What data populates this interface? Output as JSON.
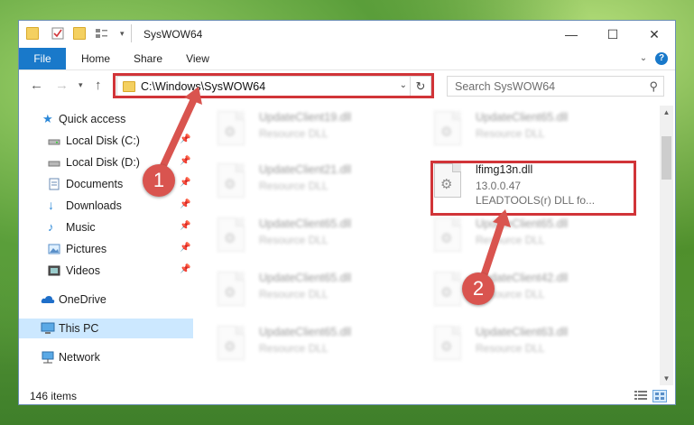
{
  "window": {
    "title": "SysWOW64",
    "controls": [
      "—",
      "☐",
      "✕"
    ]
  },
  "ribbon": {
    "tabs": [
      "File",
      "Home",
      "Share",
      "View"
    ],
    "help": "?"
  },
  "nav": {
    "address": "C:\\Windows\\SysWOW64",
    "search_placeholder": "Search SysWOW64"
  },
  "sidebar": {
    "items": [
      {
        "label": "Quick access",
        "icon": "star-icon"
      },
      {
        "label": "Local Disk (C:)",
        "icon": "drive-icon"
      },
      {
        "label": "Local Disk (D:)",
        "icon": "drive-icon"
      },
      {
        "label": "Documents",
        "icon": "documents-icon"
      },
      {
        "label": "Downloads",
        "icon": "download-icon"
      },
      {
        "label": "Music",
        "icon": "music-icon"
      },
      {
        "label": "Pictures",
        "icon": "pictures-icon"
      },
      {
        "label": "Videos",
        "icon": "videos-icon"
      },
      {
        "label": "OneDrive",
        "icon": "cloud-icon"
      },
      {
        "label": "This PC",
        "icon": "computer-icon"
      },
      {
        "label": "Network",
        "icon": "network-icon"
      }
    ]
  },
  "files": [
    {
      "name": "UpdateClient19.dll",
      "line2": "Resource DLL"
    },
    {
      "name": "UpdateClient65.dll",
      "line2": "Resource DLL"
    },
    {
      "name": "UpdateClient21.dll",
      "line2": "Resource DLL"
    },
    {
      "name": "lfimg13n.dll",
      "line2": "13.0.0.47",
      "line3": "LEADTOOLS(r) DLL fo..."
    },
    {
      "name": "UpdateClient65.dll",
      "line2": "Resource DLL"
    },
    {
      "name": "UpdateClient65.dll",
      "line2": "Resource DLL"
    },
    {
      "name": "UpdateClient65.dll",
      "line2": "Resource DLL"
    },
    {
      "name": "UpdateClient42.dll",
      "line2": "Resource DLL"
    },
    {
      "name": "UpdateClient65.dll",
      "line2": "Resource DLL"
    },
    {
      "name": "UpdateClient63.dll",
      "line2": "Resource DLL"
    }
  ],
  "status": {
    "count": "146 items"
  },
  "steps": [
    "1",
    "2"
  ],
  "colors": {
    "accent": "#1979ca",
    "highlight_red": "#d13438",
    "badge_red": "#d9544f",
    "selection": "#cce8ff"
  }
}
